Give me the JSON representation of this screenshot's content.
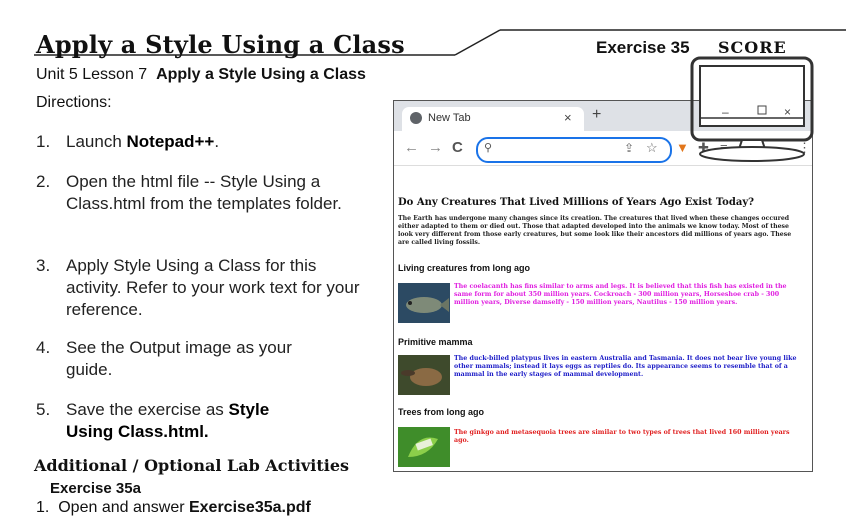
{
  "header": {
    "title": "Apply a Style Using a Class",
    "exercise": "Exercise 35",
    "score": "SCORE"
  },
  "lesson": {
    "prefix": "Unit 5 Lesson 7",
    "name": "Apply a Style Using a Class"
  },
  "directions_label": "Directions:",
  "steps": [
    {
      "num": "1.",
      "pre": "Launch ",
      "bold": "Notepad++",
      "post": "."
    },
    {
      "num": "2.",
      "text": "Open the html file -- Style Using a Class.html from the templates folder."
    },
    {
      "num": "3.",
      "text": "Apply Style Using a Class for this activity. Refer to your work text for your reference."
    },
    {
      "num": "4.",
      "text": "See the Output image as your guide."
    },
    {
      "num": "5.",
      "pre": "Save the exercise as ",
      "bold": "Style Using Class.html."
    }
  ],
  "additional": {
    "heading": "Additional / Optional Lab Activities",
    "exercise": "Exercise 35a",
    "item_num": "1.",
    "item_pre": "Open and answer ",
    "item_bold": "Exercise35a.pdf"
  },
  "browser": {
    "tab_title": "New Tab",
    "tab_close": "×",
    "new_tab": "+",
    "back": "←",
    "forward": "→",
    "reload": "C",
    "search_glyph": "⚲",
    "page": {
      "heading": "Do Any Creatures That Lived Millions of Years Ago Exist Today?",
      "intro": "The Earth has undergone many changes since its creation. The creatures that lived when these changes occured either adapted to them or died out. Those that adapted developed into the animals we know today. Most of these look very different from those early creatures, but some look like their ancestors did millions of years ago. These are called living fossils.",
      "sections": [
        {
          "title": "Living creatures from long ago",
          "color": "#e020e0",
          "text": "The coelacanth has fins similar to arms and legs. It is believed that this fish has existed in the same form for about 350 million years. Cockroach - 300 million years, Horseshoe crab - 300 million years, Diverse damselfy - 150 million years, Nautilus - 150 million years."
        },
        {
          "title": "Primitive mamma",
          "color": "#2020c8",
          "text": "The duck-billed platypus lives in eastern Australia and Tasmania. It does not bear live young like other mammals; instead it lays eggs as reptiles do. Its appearance seems to resemble that of a mammal in the early stages of mammal development."
        },
        {
          "title": "Trees from long ago",
          "color": "#e02020",
          "text": "The ginkgo and metasequoia trees are similar to two types of trees that lived 160 million years ago."
        }
      ]
    }
  }
}
